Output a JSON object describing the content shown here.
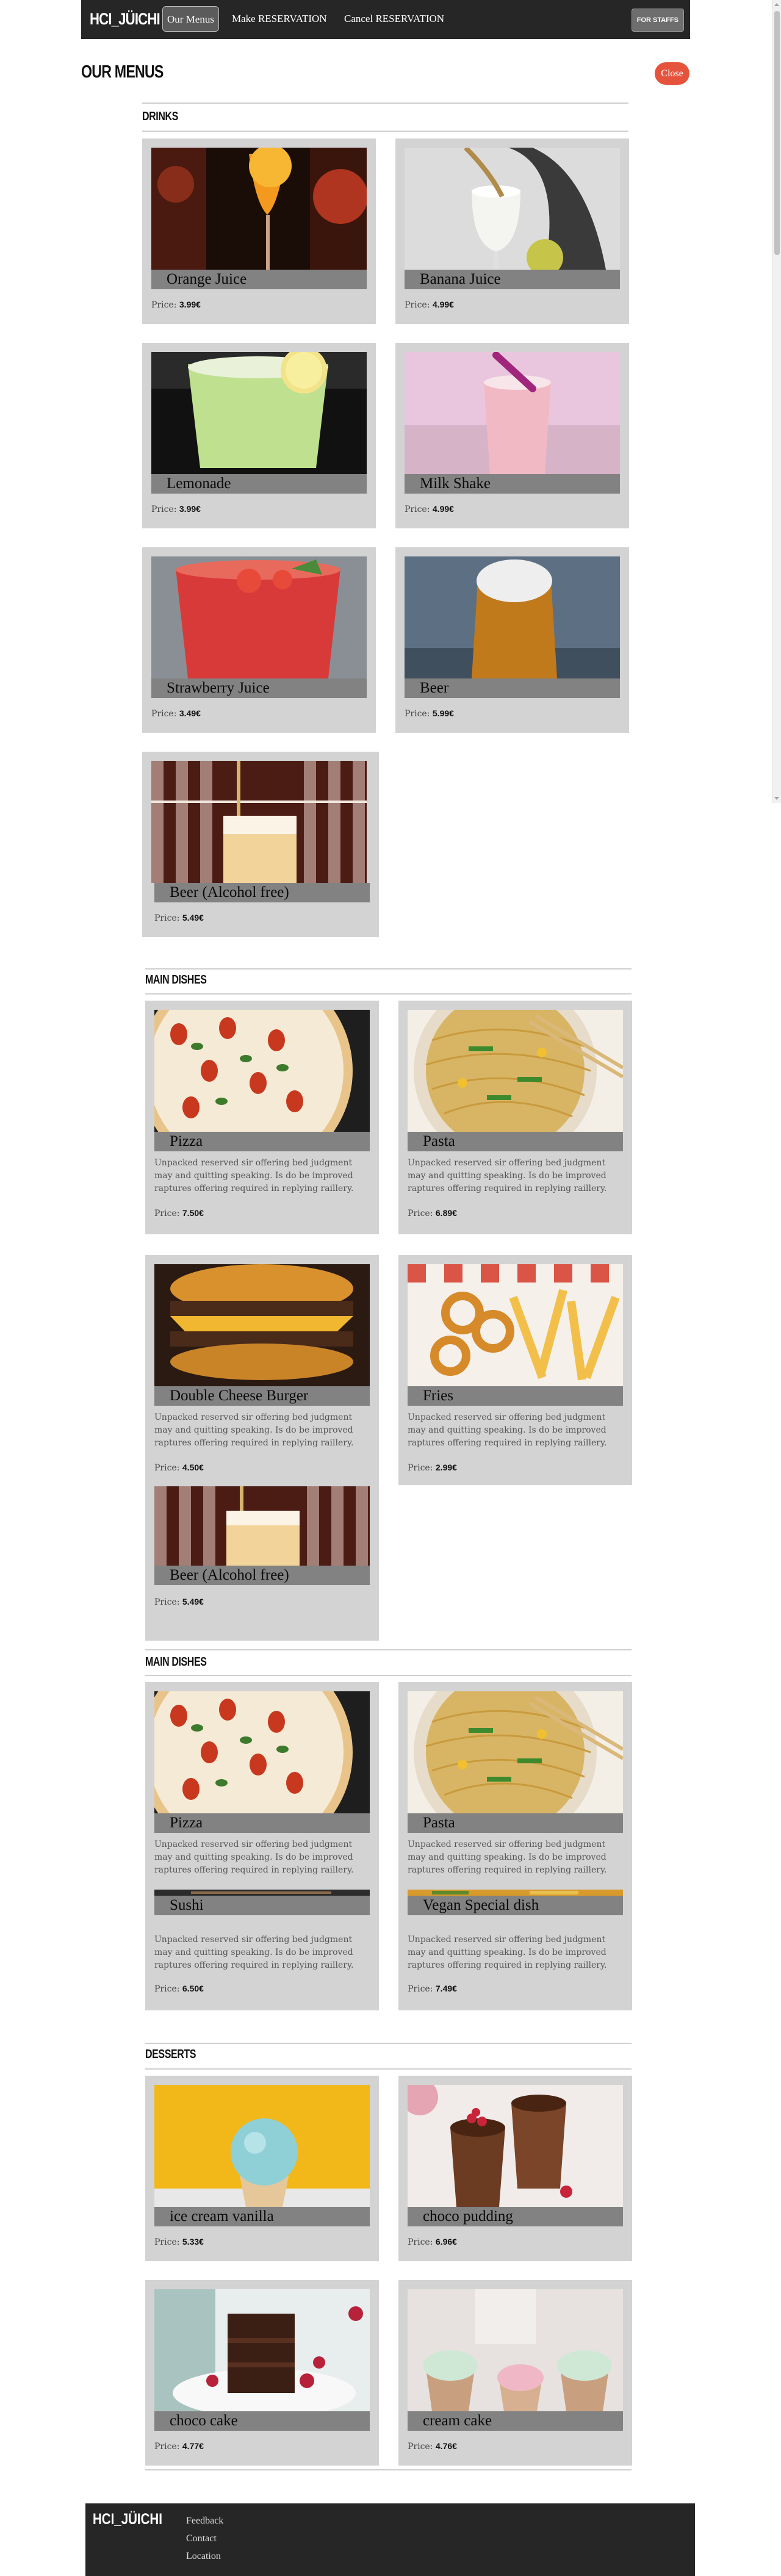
{
  "nav": {
    "brand": "HCI_JÜICHI",
    "links": [
      "Our Menus",
      "Make RESERVATION",
      "Cancel RESERVATION"
    ],
    "staff_button": "FOR STAFFS"
  },
  "page": {
    "title": "OUR MENUS",
    "close_label": "Close"
  },
  "sections": [
    {
      "title": "DRINKS",
      "items": [
        {
          "name": "Orange Juice",
          "price_label": "Price:",
          "price": "3.99€",
          "photo": "orange-juice"
        },
        {
          "name": "Banana Juice",
          "price_label": "Price:",
          "price": "4.99€",
          "photo": "banana-juice"
        },
        {
          "name": "Lemonade",
          "price_label": "Price:",
          "price": "3.99€",
          "photo": "lemonade"
        },
        {
          "name": "Milk Shake",
          "price_label": "Price:",
          "price": "4.99€",
          "photo": "milk-shake"
        },
        {
          "name": "Strawberry Juice",
          "price_label": "Price:",
          "price": "3.49€",
          "photo": "strawberry-juice"
        },
        {
          "name": "Beer",
          "price_label": "Price:",
          "price": "5.99€",
          "photo": "beer"
        },
        {
          "name": "Beer (Alcohol free)",
          "price_label": "Price:",
          "price": "5.49€",
          "photo": "beer-alcohol-free"
        }
      ]
    },
    {
      "title": "MAIN DISHES",
      "items": [
        {
          "name": "Pizza",
          "desc": "Unpacked reserved sir offering bed judgment may and quitting speaking. Is do be improved raptures offering required in replying raillery.",
          "price_label": "Price:",
          "price": "7.50€",
          "photo": "pizza"
        },
        {
          "name": "Pasta",
          "desc": "Unpacked reserved sir offering bed judgment may and quitting speaking. Is do be improved raptures offering required in replying raillery.",
          "price_label": "Price:",
          "price": "6.89€",
          "photo": "pasta"
        },
        {
          "name": "Double Cheese Burger",
          "desc": "Unpacked reserved sir offering bed judgment may and quitting speaking. Is do be improved raptures offering required in replying raillery.",
          "price_label": "Price:",
          "price": "4.50€",
          "photo": "burger"
        },
        {
          "name": "Fries",
          "desc": "Unpacked reserved sir offering bed judgment may and quitting speaking. Is do be improved raptures offering required in replying raillery.",
          "price_label": "Price:",
          "price": "2.99€",
          "photo": "fries"
        },
        {
          "name": "Beer (Alcohol free)",
          "price_label": "Price:",
          "price": "5.49€",
          "photo": "beer-alcohol-free"
        }
      ]
    },
    {
      "title": "MAIN DISHES",
      "items": [
        {
          "name": "Pizza",
          "desc": "Unpacked reserved sir offering bed judgment may and quitting speaking. Is do be improved raptures offering required in replying raillery.",
          "photo": "pizza"
        },
        {
          "name": "Pasta",
          "desc": "Unpacked reserved sir offering bed judgment may and quitting speaking. Is do be improved raptures offering required in replying raillery.",
          "photo": "pasta"
        },
        {
          "name": "Sushi",
          "desc": "Unpacked reserved sir offering bed judgment may and quitting speaking. Is do be improved raptures offering required in replying raillery.",
          "price_label": "Price:",
          "price": "6.50€",
          "photo": "sushi"
        },
        {
          "name": "Vegan Special dish",
          "desc": "Unpacked reserved sir offering bed judgment may and quitting speaking. Is do be improved raptures offering required in replying raillery.",
          "price_label": "Price:",
          "price": "7.49€",
          "photo": "vegan"
        }
      ]
    },
    {
      "title": "DESSERTS",
      "items": [
        {
          "name": "ice cream vanilla",
          "price_label": "Price:",
          "price": "5.33€",
          "photo": "ice-cream"
        },
        {
          "name": "choco pudding",
          "price_label": "Price:",
          "price": "6.96€",
          "photo": "choco-pudding"
        },
        {
          "name": "choco cake",
          "price_label": "Price:",
          "price": "4.77€",
          "photo": "choco-cake"
        },
        {
          "name": "cream cake",
          "price_label": "Price:",
          "price": "4.76€",
          "photo": "cream-cake"
        }
      ]
    }
  ],
  "footer": {
    "brand": "HCI_JÜICHI",
    "links": [
      "Feedback",
      "Contact",
      "Location"
    ]
  }
}
